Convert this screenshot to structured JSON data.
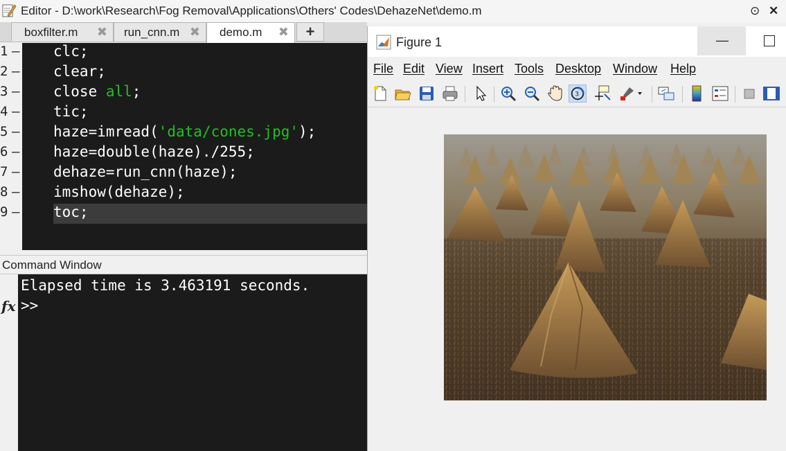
{
  "editor": {
    "title": "Editor - D:\\work\\Research\\Fog Removal\\Applications\\Others' Codes\\DehazeNet\\demo.m",
    "tabs": [
      {
        "label": "boxfilter.m"
      },
      {
        "label": "run_cnn.m"
      },
      {
        "label": "demo.m",
        "active": true
      }
    ],
    "add_tab": "+",
    "line_numbers": [
      "1",
      "2",
      "3",
      "4",
      "5",
      "6",
      "7",
      "8",
      "9"
    ],
    "dash": "–",
    "code": {
      "l1": "clc;",
      "l2": "clear;",
      "l3_a": "close ",
      "l3_b": "all",
      "l3_c": ";",
      "l4": "tic;",
      "l5_a": "haze=imread(",
      "l5_b": "'data/cones.jpg'",
      "l5_c": ");",
      "l6": "haze=double(haze)./255;",
      "l7": "dehaze=run_cnn(haze);",
      "l8": "imshow(dehaze);",
      "l9": "toc;"
    }
  },
  "command_window": {
    "title": "Command Window",
    "fx": "fx",
    "output": "Elapsed time is 3.463191 seconds.",
    "prompt": ">>"
  },
  "figure": {
    "title": "Figure 1",
    "menus": [
      {
        "label": "File"
      },
      {
        "label": "Edit"
      },
      {
        "label": "View"
      },
      {
        "label": "Insert"
      },
      {
        "label": "Tools"
      },
      {
        "label": "Desktop"
      },
      {
        "label": "Window"
      },
      {
        "label": "Help"
      }
    ],
    "toolbar_icons": [
      "new-figure-icon",
      "open-file-icon",
      "save-icon",
      "print-icon",
      "pointer-icon",
      "zoom-in-icon",
      "zoom-out-icon",
      "pan-hand-icon",
      "rotate-3d-icon",
      "data-cursor-icon",
      "brush-icon",
      "link-plot-icon",
      "colorbar-icon",
      "legend-icon",
      "hide-plot-tools-icon",
      "show-plot-tools-icon"
    ],
    "image_desc": "haystacks-field"
  },
  "colors": {
    "code_bg": "#1b1b1b",
    "string_green": "#22c022",
    "highlight_line": "#3c3c3c"
  }
}
